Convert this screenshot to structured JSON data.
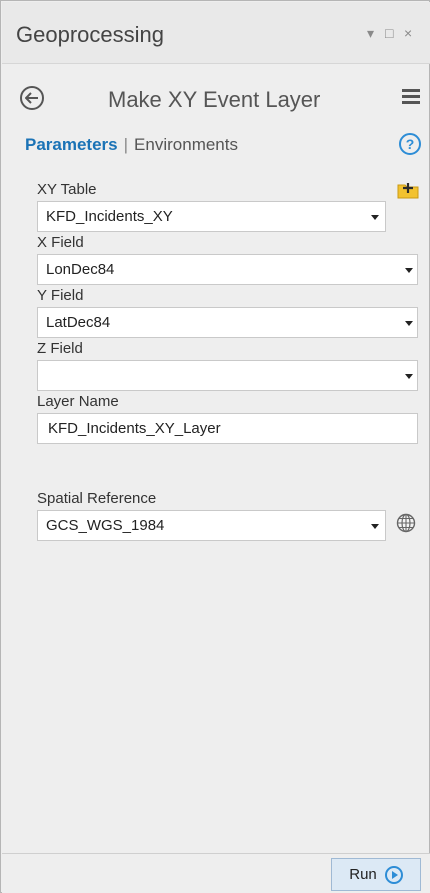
{
  "window": {
    "title": "Geoprocessing",
    "pin_glyph": "▾",
    "maximize_glyph": "□",
    "close_glyph": "×"
  },
  "tool": {
    "title": "Make XY Event Layer"
  },
  "tabs": {
    "parameters": "Parameters",
    "separator": "|",
    "environments": "Environments",
    "help_glyph": "?"
  },
  "params": {
    "xy_table": {
      "label": "XY Table",
      "value": "KFD_Incidents_XY"
    },
    "x_field": {
      "label": "X Field",
      "value": "LonDec84"
    },
    "y_field": {
      "label": "Y Field",
      "value": "LatDec84"
    },
    "z_field": {
      "label": "Z Field",
      "value": ""
    },
    "layer_name": {
      "label": "Layer Name",
      "value": "KFD_Incidents_XY_Layer"
    },
    "spatial_reference": {
      "label": "Spatial Reference",
      "value": "GCS_WGS_1984"
    }
  },
  "footer": {
    "run_label": "Run"
  },
  "colors": {
    "accent": "#1b73b6",
    "icon_blue": "#2d8dd6",
    "folder_yellow": "#f2c230"
  },
  "icons": {
    "back": "back-arrow-icon",
    "menu": "hamburger-menu-icon",
    "help": "help-icon",
    "add_data": "add-data-folder-icon",
    "globe": "globe-icon",
    "run": "play-icon"
  }
}
